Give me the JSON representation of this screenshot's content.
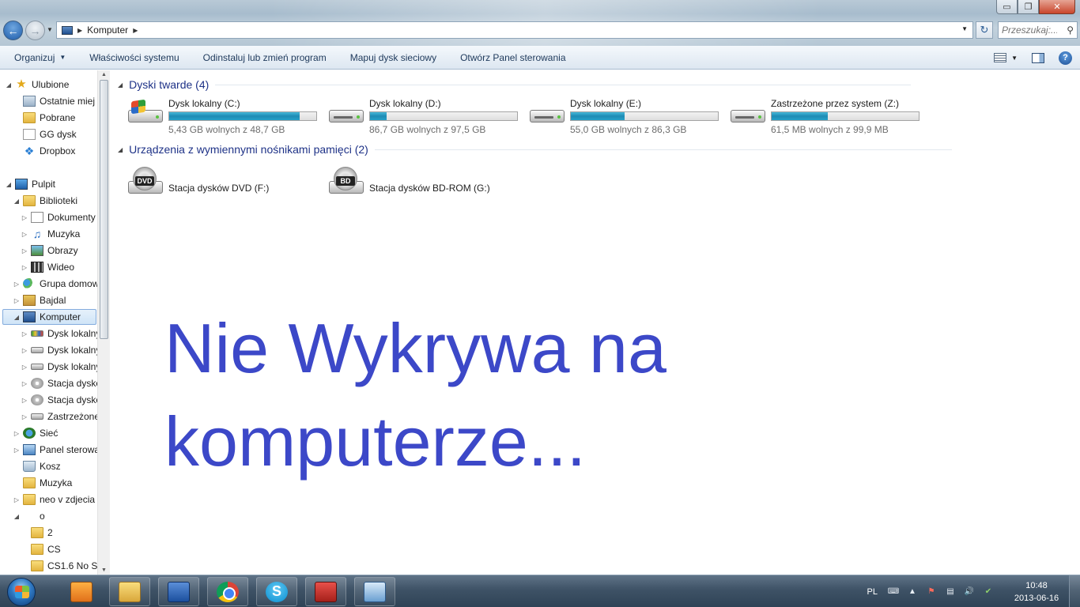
{
  "window": {
    "controls": {
      "minimize": "▭",
      "maximize": "❐",
      "close": "✕"
    }
  },
  "address": {
    "path": "Komputer",
    "search_placeholder": "Przeszukaj:..."
  },
  "command_bar": {
    "items": [
      {
        "label": "Organizuj",
        "has_dropdown": true
      },
      {
        "label": "Właściwości systemu"
      },
      {
        "label": "Odinstaluj lub zmień program"
      },
      {
        "label": "Mapuj dysk sieciowy"
      },
      {
        "label": "Otwórz Panel sterowania"
      }
    ]
  },
  "nav_tree": {
    "items": [
      {
        "label": "Ulubione",
        "icon": "star-icon"
      },
      {
        "label": "Ostatnie miej",
        "icon": "recent-places-icon"
      },
      {
        "label": "Pobrane",
        "icon": "downloads-folder-icon"
      },
      {
        "label": "GG dysk",
        "icon": "gg-drive-icon"
      },
      {
        "label": "Dropbox",
        "icon": "dropbox-icon"
      },
      {
        "label": "Pulpit",
        "icon": "desktop-icon"
      },
      {
        "label": "Biblioteki",
        "icon": "libraries-icon"
      },
      {
        "label": "Dokumenty",
        "icon": "documents-icon"
      },
      {
        "label": "Muzyka",
        "icon": "music-icon"
      },
      {
        "label": "Obrazy",
        "icon": "pictures-icon"
      },
      {
        "label": "Wideo",
        "icon": "video-icon"
      },
      {
        "label": "Grupa domow",
        "icon": "homegroup-icon"
      },
      {
        "label": "Bajdal",
        "icon": "user-folder-icon"
      },
      {
        "label": "Komputer",
        "icon": "computer-icon",
        "selected": true
      },
      {
        "label": "Dysk lokalny",
        "icon": "system-drive-icon"
      },
      {
        "label": "Dysk lokalny",
        "icon": "drive-icon"
      },
      {
        "label": "Dysk lokalny",
        "icon": "drive-icon"
      },
      {
        "label": "Stacja dysko",
        "icon": "dvd-drive-icon"
      },
      {
        "label": "Stacja dysko",
        "icon": "bd-drive-icon"
      },
      {
        "label": "Zastrzeżone",
        "icon": "drive-icon"
      },
      {
        "label": "Sieć",
        "icon": "network-icon"
      },
      {
        "label": "Panel sterowa",
        "icon": "control-panel-icon"
      },
      {
        "label": "Kosz",
        "icon": "recycle-bin-icon"
      },
      {
        "label": "Muzyka",
        "icon": "folder-icon"
      },
      {
        "label": "neo v zdjecia",
        "icon": "folder-icon"
      },
      {
        "label": "o",
        "icon": ""
      },
      {
        "label": "2",
        "icon": "folder-icon"
      },
      {
        "label": "CS",
        "icon": "folder-icon"
      },
      {
        "label": "CS1.6 No St",
        "icon": "folder-icon"
      }
    ]
  },
  "groups": {
    "hard_disks": {
      "title": "Dyski twarde (4)"
    },
    "removable": {
      "title": "Urządzenia z wymiennymi nośnikami pamięci (2)"
    }
  },
  "drives": [
    {
      "name": "Dysk lokalny (C:)",
      "free_text": "5,43 GB wolnych z 48,7 GB",
      "used_fraction": 0.888,
      "system": true
    },
    {
      "name": "Dysk lokalny (D:)",
      "free_text": "86,7 GB wolnych z 97,5 GB",
      "used_fraction": 0.111
    },
    {
      "name": "Dysk lokalny (E:)",
      "free_text": "55,0 GB wolnych z 86,3 GB",
      "used_fraction": 0.363
    },
    {
      "name": "Zastrzeżone przez system (Z:)",
      "free_text": "61,5 MB wolnych z 99,9 MB",
      "used_fraction": 0.384
    }
  ],
  "removable_drives": [
    {
      "name": "Stacja dysków DVD (F:)",
      "badge": "DVD"
    },
    {
      "name": "Stacja dysków BD-ROM (G:)",
      "badge": "BD"
    }
  ],
  "overlay": {
    "line1": "Nie Wykrywa na",
    "line2": "komputerze..."
  },
  "taskbar": {
    "apps": [
      "windows-media-center",
      "windows-explorer",
      "microsoft-word",
      "google-chrome",
      "skype",
      "toolbox",
      "network-settings"
    ],
    "tray": {
      "language": "PL",
      "time": "10:48",
      "date": "2013-06-16"
    }
  }
}
